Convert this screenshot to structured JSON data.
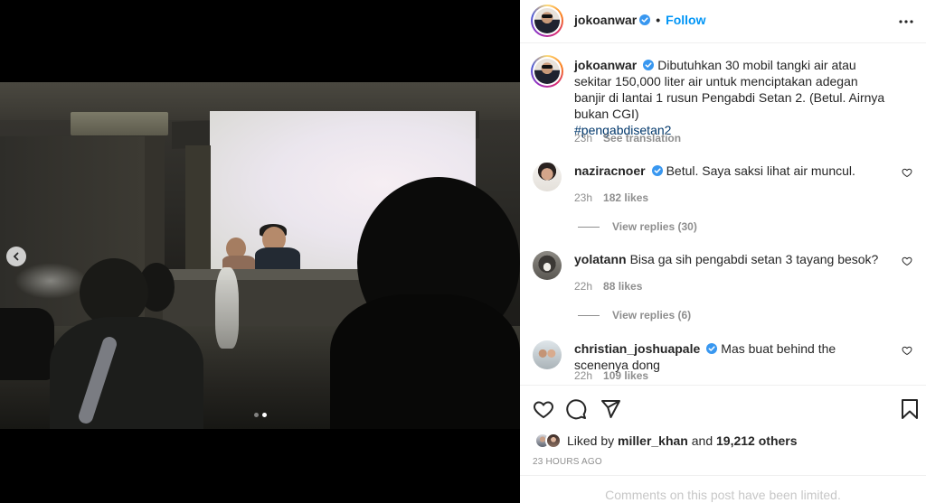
{
  "post": {
    "author": "jokoanwar",
    "follow_label": "Follow",
    "separator": "•",
    "caption": {
      "text": "Dibutuhkan 30 mobil tangki air atau sekitar 150,000 liter air untuk menciptakan adegan banjir di lantai 1 rusun Pengabdi Setan 2. (Betul. Airnya bukan CGI)",
      "hashtag": "#pengabdisetan2",
      "time": "23h",
      "translate_label": "See translation"
    },
    "carousel": {
      "slide_count": 2,
      "active_slide": 2
    }
  },
  "comments": [
    {
      "username": "naziracnoer",
      "verified": true,
      "text": "Betul. Saya saksi lihat air muncul.",
      "time": "23h",
      "likes": "182 likes",
      "replies": "View replies (30)"
    },
    {
      "username": "yolatann",
      "verified": false,
      "text": "Bisa ga sih pengabdi setan 3 tayang besok?",
      "time": "22h",
      "likes": "88 likes",
      "replies": "View replies (6)"
    },
    {
      "username": "christian_joshuapale",
      "verified": true,
      "text": "Mas buat behind the scenenya dong",
      "time": "22h",
      "likes": "109 likes",
      "replies": ""
    }
  ],
  "likes_summary": {
    "prefix": "Liked by",
    "user": "miller_khan",
    "conjunction": "and",
    "others": "19,212 others"
  },
  "timestamp": "23 HOURS AGO",
  "comments_limited": "Comments on this post have been limited.",
  "colors": {
    "accent": "#0095f6",
    "verified": "#3897f0",
    "muted": "#8e8e8e",
    "hashtag": "#00376b"
  },
  "icons": [
    "verified-icon",
    "more-options-icon",
    "heart-icon",
    "comment-icon",
    "share-icon",
    "bookmark-icon",
    "chevron-left-icon"
  ]
}
